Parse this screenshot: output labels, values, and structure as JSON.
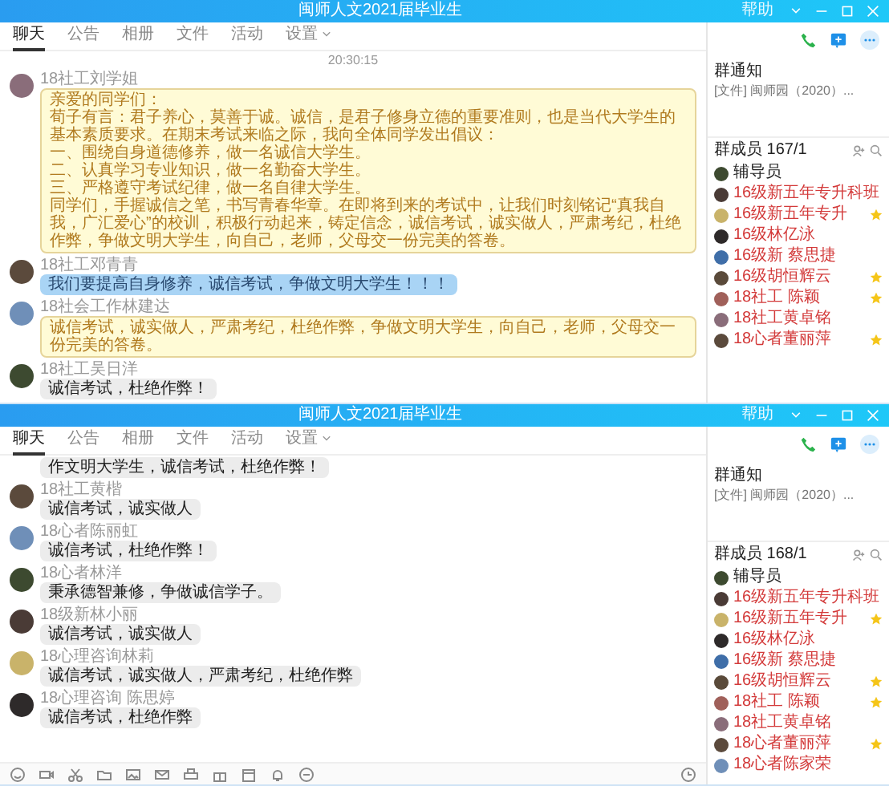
{
  "windows": [
    {
      "title": "闽师人文2021届毕业生",
      "title_bar_text": "帮助",
      "tabs": [
        {
          "label": "聊天",
          "selected": true
        },
        {
          "label": "公告",
          "selected": false
        },
        {
          "label": "相册",
          "selected": false
        },
        {
          "label": "文件",
          "selected": false
        },
        {
          "label": "活动",
          "selected": false
        },
        {
          "label": "设置",
          "selected": false,
          "dropdown": true
        }
      ],
      "time": "20:30:15",
      "messages": [
        {
          "sender": "18社工刘学姐",
          "kind": "yellow",
          "lines": [
            "亲爱的同学们：",
            "荀子有言：君子养心，莫善于诚。诚信，是君子修身立德的重要准则，也是当代大学生的基本素质要求。在期末考试来临之际，我向全体同学发出倡议：",
            "一、围绕自身道德修养，做一名诚信大学生。",
            "二、认真学习专业知识，做一名勤奋大学生。",
            "三、严格遵守考试纪律，做一名自律大学生。",
            "同学们，手握诚信之笔，书写青春华章。在即将到来的考试中，让我们时刻铭记“真我自我，广汇爱心”的校训，积极行动起来，铸定信念，诚信考试，诚实做人，严肃考纪，杜绝作弊，争做文明大学生，向自己，老师，父母交一份完美的答卷。"
          ]
        },
        {
          "sender": "18社工邓青青",
          "kind": "blue",
          "lines": [
            "我们要提高自身修养，诚信考试，争做文明大学生！！！"
          ]
        },
        {
          "sender": "18社会工作林建达",
          "kind": "yellow",
          "lines": [
            "诚信考试，诚实做人，严肃考纪，杜绝作弊，争做文明大学生，向自己，老师，父母交一份完美的答卷。"
          ]
        },
        {
          "sender": "18社工吴日洋",
          "kind": "gray",
          "lines": [
            "诚信考试，杜绝作弊！"
          ]
        }
      ],
      "notice": {
        "title": "群通知",
        "text": "[文件] 闽师园（2020）..."
      },
      "members_header": "群成员 167/1",
      "members": [
        {
          "name": "辅导员",
          "kind": "admin",
          "starred": false
        },
        {
          "name": "16级新五年专升科班",
          "kind": "member",
          "starred": false
        },
        {
          "name": "16级新五年专升",
          "kind": "member",
          "starred": true
        },
        {
          "name": "16级林亿泳",
          "kind": "member",
          "starred": false
        },
        {
          "name": "16级新 蔡思捷",
          "kind": "member",
          "starred": false
        },
        {
          "name": "16级胡恒辉云",
          "kind": "member",
          "starred": true
        },
        {
          "name": "18社工 陈颖",
          "kind": "member",
          "starred": true
        },
        {
          "name": "18社工黄卓铭",
          "kind": "member",
          "starred": false
        },
        {
          "name": "18心者董丽萍",
          "kind": "member",
          "starred": true
        }
      ]
    },
    {
      "title": "闽师人文2021届毕业生",
      "title_bar_text": "帮助",
      "tabs": [
        {
          "label": "聊天",
          "selected": true
        },
        {
          "label": "公告",
          "selected": false
        },
        {
          "label": "相册",
          "selected": false
        },
        {
          "label": "文件",
          "selected": false
        },
        {
          "label": "活动",
          "selected": false
        },
        {
          "label": "设置",
          "selected": false,
          "dropdown": true
        }
      ],
      "messages": [
        {
          "kind": "gray",
          "lines": [
            "作文明大学生，诚信考试，杜绝作弊！"
          ]
        },
        {
          "sender": "18社工黄楷",
          "kind": "gray",
          "lines": [
            "诚信考试，诚实做人"
          ]
        },
        {
          "sender": "18心者陈丽虹",
          "kind": "gray",
          "lines": [
            "诚信考试，杜绝作弊！"
          ]
        },
        {
          "sender": "18心者林洋",
          "kind": "gray",
          "lines": [
            "秉承德智兼修，争做诚信学子。"
          ]
        },
        {
          "sender": "18级新林小丽",
          "kind": "gray",
          "lines": [
            "诚信考试，诚实做人"
          ]
        },
        {
          "sender": "18心理咨询林莉",
          "kind": "gray",
          "lines": [
            "诚信考试，诚实做人，严肃考纪，杜绝作弊"
          ]
        },
        {
          "sender": "18心理咨询 陈思婷",
          "kind": "gray",
          "lines": [
            "诚信考试，杜绝作弊"
          ]
        }
      ],
      "toolbar": true,
      "notice": {
        "title": "群通知",
        "text": "[文件] 闽师园（2020）..."
      },
      "members_header": "群成员 168/1",
      "members": [
        {
          "name": "辅导员",
          "kind": "admin",
          "starred": false
        },
        {
          "name": "16级新五年专升科班",
          "kind": "member",
          "starred": false
        },
        {
          "name": "16级新五年专升",
          "kind": "member",
          "starred": true
        },
        {
          "name": "16级林亿泳",
          "kind": "member",
          "starred": false
        },
        {
          "name": "16级新 蔡思捷",
          "kind": "member",
          "starred": false
        },
        {
          "name": "16级胡恒辉云",
          "kind": "member",
          "starred": true
        },
        {
          "name": "18社工 陈颖",
          "kind": "member",
          "starred": true
        },
        {
          "name": "18社工黄卓铭",
          "kind": "member",
          "starred": false
        },
        {
          "name": "18心者董丽萍",
          "kind": "member",
          "starred": true
        },
        {
          "name": "18心者陈家荣",
          "kind": "member",
          "starred": false
        }
      ]
    }
  ]
}
